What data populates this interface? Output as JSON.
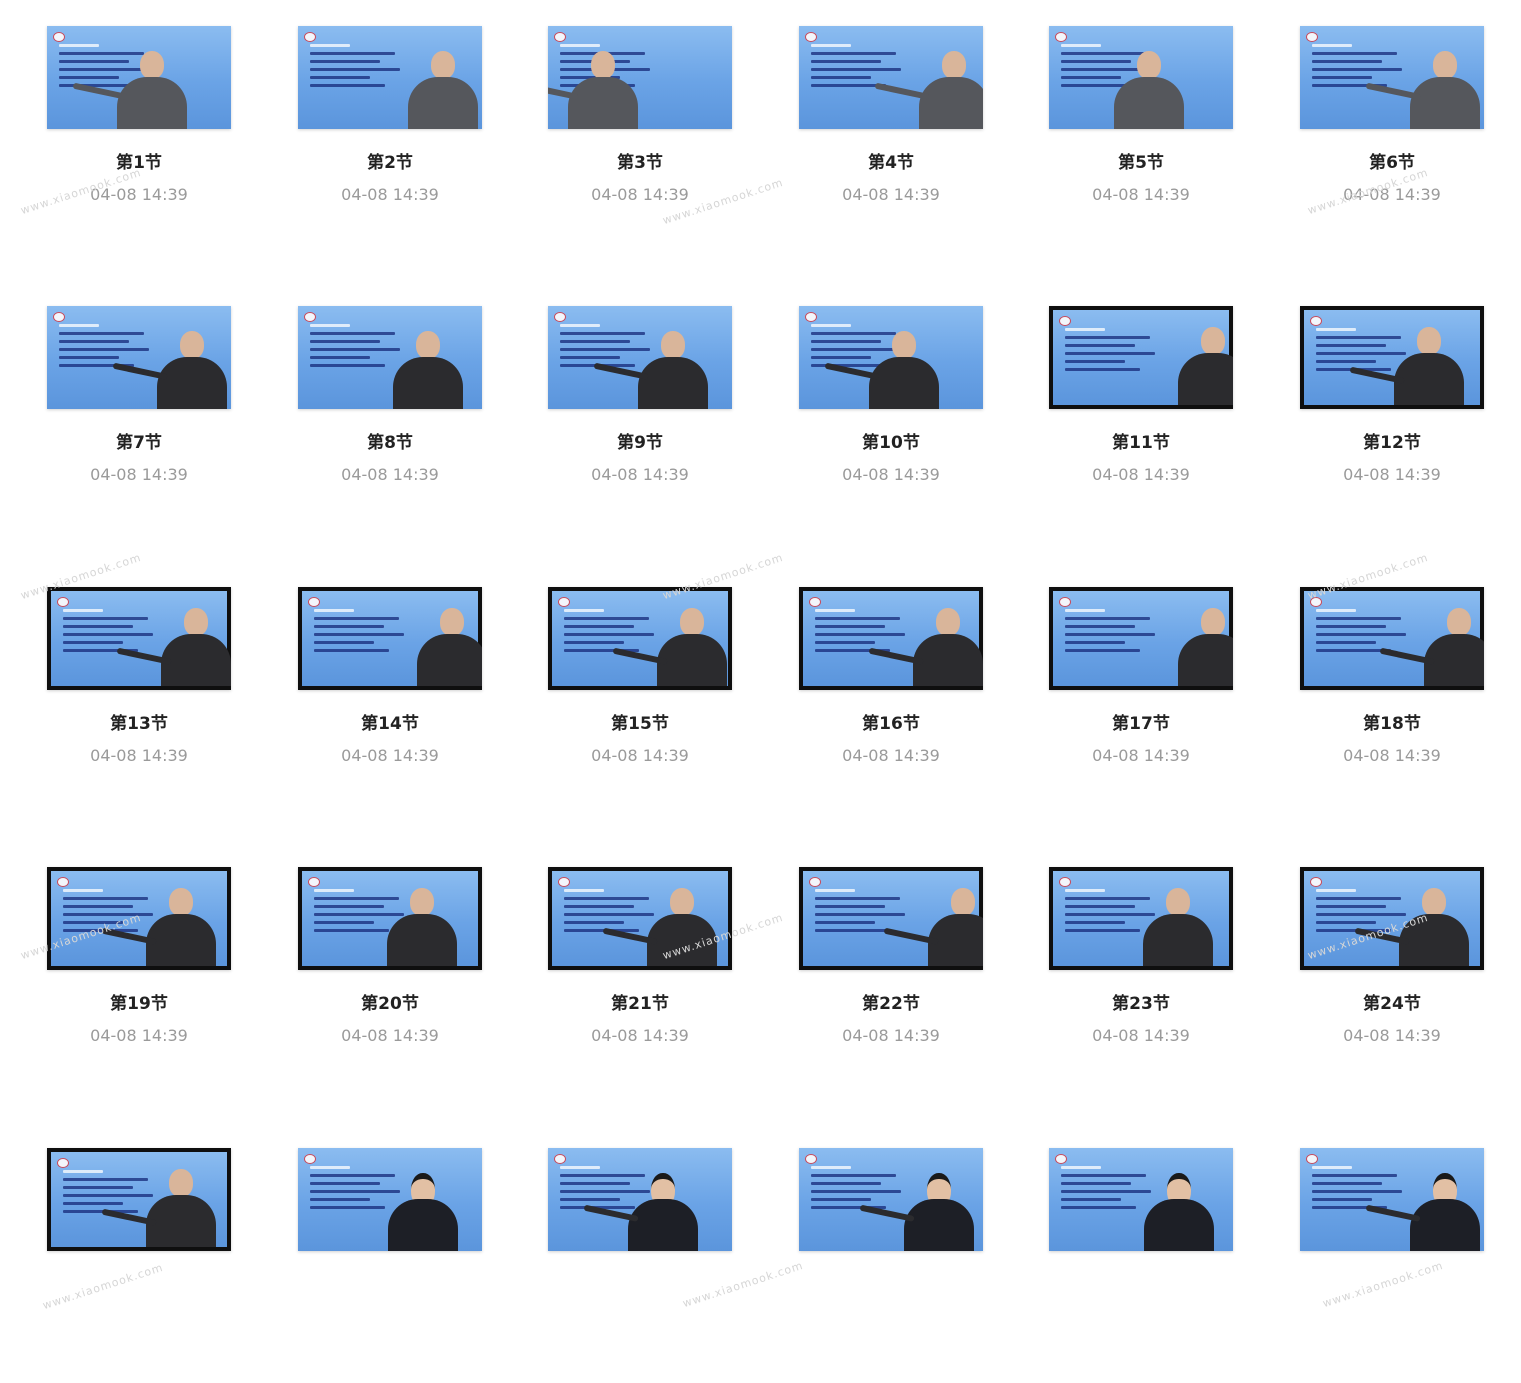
{
  "watermark_text": "www.xiaomook.com",
  "items": [
    {
      "label": "第1节",
      "date": "04-08 14:39"
    },
    {
      "label": "第2节",
      "date": "04-08 14:39"
    },
    {
      "label": "第3节",
      "date": "04-08 14:39"
    },
    {
      "label": "第4节",
      "date": "04-08 14:39"
    },
    {
      "label": "第5节",
      "date": "04-08 14:39"
    },
    {
      "label": "第6节",
      "date": "04-08 14:39"
    },
    {
      "label": "第7节",
      "date": "04-08 14:39"
    },
    {
      "label": "第8节",
      "date": "04-08 14:39"
    },
    {
      "label": "第9节",
      "date": "04-08 14:39"
    },
    {
      "label": "第10节",
      "date": "04-08 14:39"
    },
    {
      "label": "第11节",
      "date": "04-08 14:39"
    },
    {
      "label": "第12节",
      "date": "04-08 14:39"
    },
    {
      "label": "第13节",
      "date": "04-08 14:39"
    },
    {
      "label": "第14节",
      "date": "04-08 14:39"
    },
    {
      "label": "第15节",
      "date": "04-08 14:39"
    },
    {
      "label": "第16节",
      "date": "04-08 14:39"
    },
    {
      "label": "第17节",
      "date": "04-08 14:39"
    },
    {
      "label": "第18节",
      "date": "04-08 14:39"
    },
    {
      "label": "第19节",
      "date": "04-08 14:39"
    },
    {
      "label": "第20节",
      "date": "04-08 14:39"
    },
    {
      "label": "第21节",
      "date": "04-08 14:39"
    },
    {
      "label": "第22节",
      "date": "04-08 14:39"
    },
    {
      "label": "第23节",
      "date": "04-08 14:39"
    },
    {
      "label": "第24节",
      "date": "04-08 14:39"
    },
    {
      "label": "",
      "date": ""
    },
    {
      "label": "",
      "date": ""
    },
    {
      "label": "",
      "date": ""
    },
    {
      "label": "",
      "date": ""
    },
    {
      "label": "",
      "date": ""
    },
    {
      "label": "",
      "date": ""
    }
  ]
}
